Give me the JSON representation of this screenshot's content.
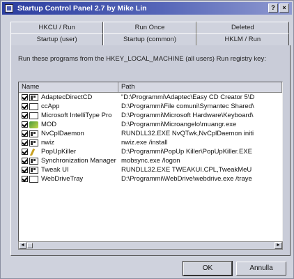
{
  "window": {
    "title": "Startup Control Panel 2.7 by Mike Lin",
    "help_label": "?",
    "close_label": "×"
  },
  "tabs": {
    "row1": [
      "HKCU / Run",
      "Run Once",
      "Deleted"
    ],
    "row2": [
      "Startup (user)",
      "Startup (common)",
      "HKLM / Run"
    ],
    "active": "HKLM / Run"
  },
  "description": "Run these programs from the HKEY_LOCAL_MACHINE (all users) Run registry key:",
  "list": {
    "columns": [
      "Name",
      "Path"
    ],
    "rows": [
      {
        "name": "AdaptecDirectCD",
        "path": "\"D:\\Programmi\\Adaptec\\Easy CD Creator 5\\D",
        "icon": "cd-icon"
      },
      {
        "name": "ccApp",
        "path": "D:\\Programmi\\File comuni\\Symantec Shared\\",
        "icon": "window-icon"
      },
      {
        "name": "Microsoft IntelliType Pro",
        "path": "D:\\Programmi\\Microsoft Hardware\\Keyboard\\",
        "icon": "keyboard-icon"
      },
      {
        "name": "MOD",
        "path": "D:\\Programmi\\Microangelo\\muangr.exe",
        "icon": "mod-icon"
      },
      {
        "name": "NvCplDaemon",
        "path": "RUNDLL32.EXE NvQTwk,NvCplDaemon initi",
        "icon": "window-icon"
      },
      {
        "name": "nwiz",
        "path": "nwiz.exe /install",
        "icon": "window-icon"
      },
      {
        "name": "PopUpKiller",
        "path": "D:\\Programmi\\PopUp Killer\\PopUpKiller.EXE",
        "icon": "popup-killer-icon"
      },
      {
        "name": "Synchronization Manager",
        "path": "mobsync.exe /logon",
        "icon": "window-icon"
      },
      {
        "name": "Tweak UI",
        "path": "RUNDLL32.EXE TWEAKUI.CPL,TweakMeU",
        "icon": "window-icon"
      },
      {
        "name": "WebDriveTray",
        "path": "D:\\Programmi\\WebDrive\\webdrive.exe /traye",
        "icon": "window-icon"
      }
    ]
  },
  "scrollbar": {
    "left_arrow": "◄",
    "right_arrow": "►"
  },
  "buttons": {
    "ok": "OK",
    "cancel": "Annulla"
  }
}
